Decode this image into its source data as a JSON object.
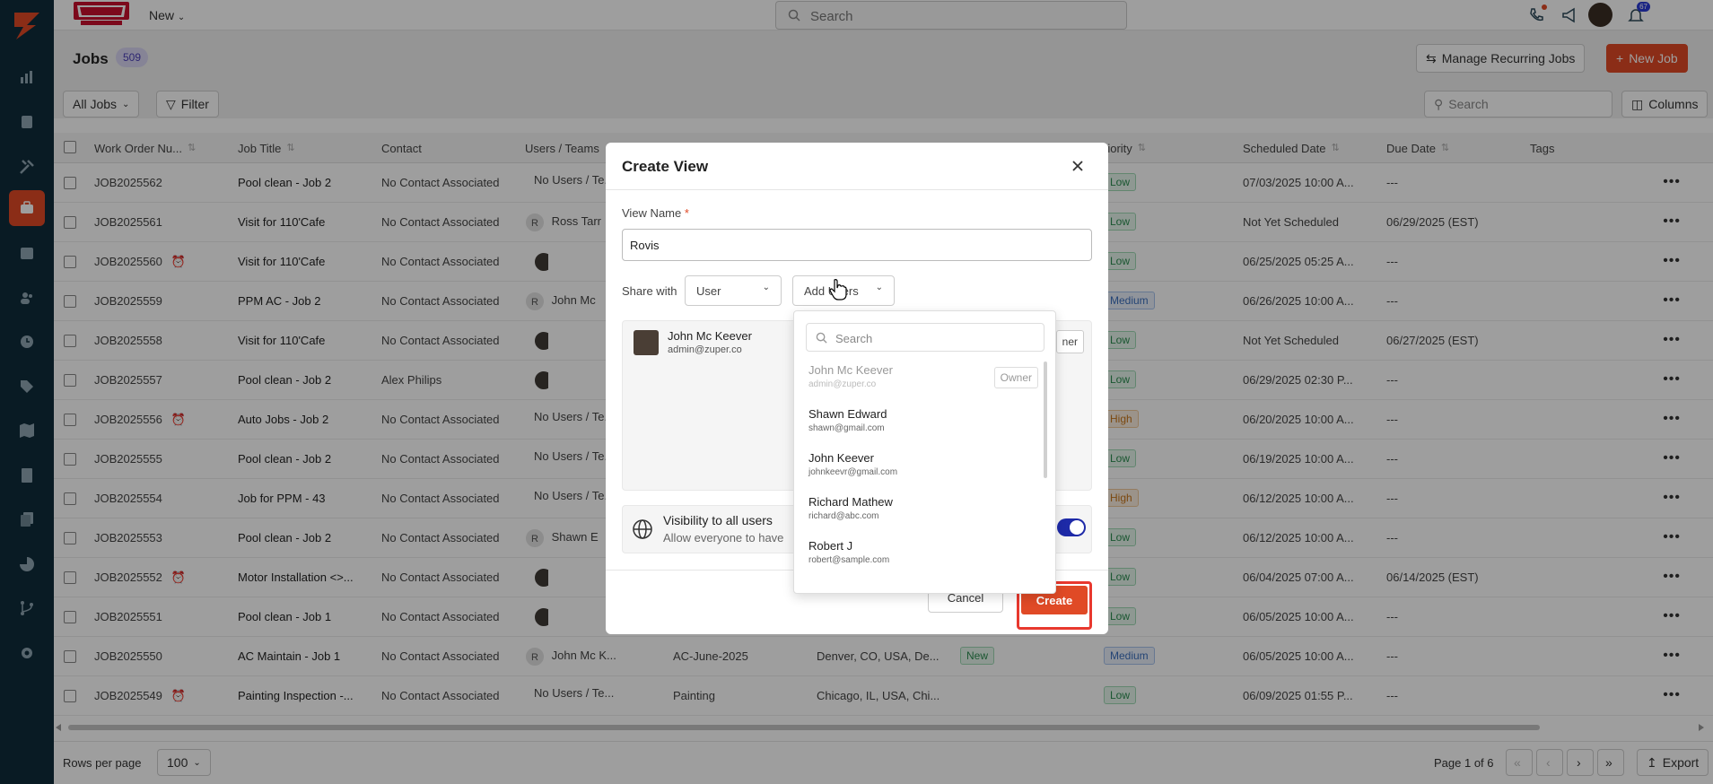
{
  "topbar": {
    "new_label": "New",
    "search_placeholder": "Search",
    "notification_count": "67"
  },
  "page": {
    "title": "Jobs",
    "count": "509",
    "manage_recurring_label": "Manage Recurring Jobs",
    "new_job_label": "New Job",
    "all_jobs_label": "All Jobs",
    "filter_label": "Filter",
    "table_search_placeholder": "Search",
    "columns_label": "Columns"
  },
  "table": {
    "headers": [
      "Work Order Nu...",
      "Job Title",
      "Contact",
      "Users / Teams",
      "riority",
      "Scheduled Date",
      "Due Date",
      "Tags"
    ],
    "rows": [
      {
        "wo": "JOB2025562",
        "alarm": false,
        "title": "Pool clean - Job 2",
        "contact": "No Contact Associated",
        "users": "No Users / Te...",
        "priority": "Low",
        "scheduled": "07/03/2025 10:00 A...",
        "due": "---"
      },
      {
        "wo": "JOB2025561",
        "alarm": false,
        "title": "Visit for 110'Cafe",
        "contact": "No Contact Associated",
        "users": "Ross Tarr",
        "priority": "Low",
        "scheduled": "Not Yet Scheduled",
        "due": "06/29/2025 (EST)"
      },
      {
        "wo": "JOB2025560",
        "alarm": true,
        "title": "Visit for 110'Cafe",
        "contact": "No Contact Associated",
        "users": "",
        "priority": "Low",
        "scheduled": "06/25/2025 05:25 A...",
        "due": "---"
      },
      {
        "wo": "JOB2025559",
        "alarm": false,
        "title": "PPM AC - Job 2",
        "contact": "No Contact Associated",
        "users": "John Mc",
        "priority": "Medium",
        "scheduled": "06/26/2025 10:00 A...",
        "due": "---"
      },
      {
        "wo": "JOB2025558",
        "alarm": false,
        "title": "Visit for 110'Cafe",
        "contact": "No Contact Associated",
        "users": "",
        "priority": "Low",
        "scheduled": "Not Yet Scheduled",
        "due": "06/27/2025 (EST)"
      },
      {
        "wo": "JOB2025557",
        "alarm": false,
        "title": "Pool clean - Job 2",
        "contact": "Alex Philips",
        "users": "",
        "priority": "Low",
        "scheduled": "06/29/2025 02:30 P...",
        "due": "---"
      },
      {
        "wo": "JOB2025556",
        "alarm": true,
        "title": "Auto Jobs - Job 2",
        "contact": "No Contact Associated",
        "users": "No Users / Te...",
        "priority": "High",
        "scheduled": "06/20/2025 10:00 A...",
        "due": "---"
      },
      {
        "wo": "JOB2025555",
        "alarm": false,
        "title": "Pool clean - Job 2",
        "contact": "No Contact Associated",
        "users": "No Users / Te...",
        "priority": "Low",
        "scheduled": "06/19/2025 10:00 A...",
        "due": "---"
      },
      {
        "wo": "JOB2025554",
        "alarm": false,
        "title": "Job for PPM - 43",
        "contact": "No Contact Associated",
        "users": "No Users / Te...",
        "priority": "High",
        "scheduled": "06/12/2025 10:00 A...",
        "due": "---"
      },
      {
        "wo": "JOB2025553",
        "alarm": false,
        "title": "Pool clean - Job 2",
        "contact": "No Contact Associated",
        "users": "Shawn E",
        "priority": "Low",
        "scheduled": "06/12/2025 10:00 A...",
        "due": "---"
      },
      {
        "wo": "JOB2025552",
        "alarm": true,
        "title": "Motor Installation <>...",
        "contact": "No Contact Associated",
        "users": "",
        "priority": "Low",
        "scheduled": "06/04/2025 07:00 A...",
        "due": "06/14/2025 (EST)"
      },
      {
        "wo": "JOB2025551",
        "alarm": false,
        "title": "Pool clean - Job 1",
        "contact": "No Contact Associated",
        "users": "",
        "priority": "Low",
        "scheduled": "06/05/2025 10:00 A...",
        "due": "---"
      },
      {
        "wo": "JOB2025550",
        "alarm": false,
        "title": "AC Maintain - Job 1",
        "contact": "No Contact Associated",
        "users": "John Mc K...",
        "extra1": "AC-June-2025",
        "extra2": "Denver, CO, USA, De...",
        "status": "New",
        "priority": "Medium",
        "scheduled": "06/05/2025 10:00 A...",
        "due": "---"
      },
      {
        "wo": "JOB2025549",
        "alarm": true,
        "title": "Painting Inspection -...",
        "contact": "No Contact Associated",
        "users": "No Users / Te...",
        "extra1": "Painting",
        "extra2": "Chicago, IL, USA, Chi...",
        "priority": "Low",
        "scheduled": "06/09/2025 01:55 P...",
        "due": "---"
      }
    ]
  },
  "footer": {
    "rows_per_page_label": "Rows per page",
    "rows_per_page_value": "100",
    "page_info": "Page 1 of 6",
    "export_label": "Export"
  },
  "modal": {
    "title": "Create View",
    "view_name_label": "View Name",
    "required_mark": "*",
    "view_name_value": "Rovis",
    "share_with_label": "Share with",
    "share_type_value": "User",
    "add_users_label": "Add Users",
    "shared_user_name": "John Mc Keever",
    "shared_user_email": "admin@zuper.co",
    "owner_partial": "ner",
    "visibility_title": "Visibility to all users",
    "visibility_desc": "Allow everyone to have",
    "cancel_label": "Cancel",
    "create_label": "Create"
  },
  "user_dropdown": {
    "search_placeholder": "Search",
    "owner_label": "Owner",
    "items": [
      {
        "name": "John Mc Keever",
        "email": "admin@zuper.co",
        "disabled": true
      },
      {
        "name": "Shawn Edward",
        "email": "shawn@gmail.com",
        "disabled": false
      },
      {
        "name": "John Keever",
        "email": "johnkeevr@gmail.com",
        "disabled": false
      },
      {
        "name": "Richard Mathew",
        "email": "richard@abc.com",
        "disabled": false
      },
      {
        "name": "Robert J",
        "email": "robert@sample.com",
        "disabled": false
      }
    ]
  },
  "colors": {
    "brand": "#e04a26",
    "sidebar": "#0f2d3b",
    "accent": "#2b3bd6"
  }
}
